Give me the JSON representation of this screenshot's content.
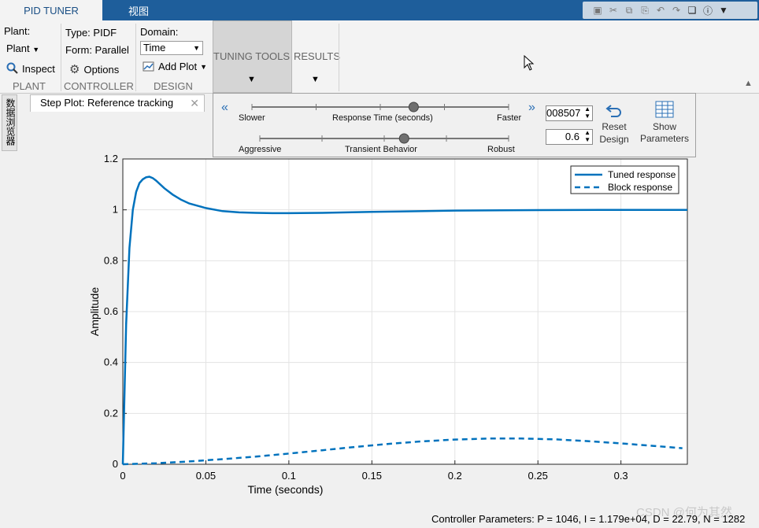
{
  "tabs": {
    "active": "PID TUNER",
    "second": "视图"
  },
  "ribbon": {
    "plant_label": "Plant:",
    "plant_value": "Plant",
    "inspect": "Inspect",
    "type": "Type: PIDF",
    "form": "Form: Parallel",
    "options": "Options",
    "domain_label": "Domain:",
    "domain_value": "Time",
    "add_plot": "Add Plot",
    "tuning_tools": "TUNING TOOLS",
    "results": "RESULTS",
    "groups": {
      "plant": "PLANT",
      "controller": "CONTROLLER",
      "design": "DESIGN"
    }
  },
  "doc": {
    "side_tab": "数据浏览器",
    "tab_title": "Step Plot: Reference tracking"
  },
  "tuner": {
    "slow_left": "Slower",
    "time_label": "Response Time (seconds)",
    "fast_right": "Faster",
    "aggr_left": "Aggressive",
    "transient_label": "Transient Behavior",
    "robust_right": "Robust",
    "response_value": "008507",
    "transient_value": "0.6",
    "reset": [
      "Reset",
      "Design"
    ],
    "show": [
      "Show",
      "Parameters"
    ],
    "response_pos": 0.63,
    "transient_pos": 0.58
  },
  "chart_data": {
    "type": "line",
    "xlabel": "Time (seconds)",
    "ylabel": "Amplitude",
    "xlim": [
      0,
      0.34
    ],
    "ylim": [
      0,
      1.2
    ],
    "xticks": [
      "0",
      "0.05",
      "0.1",
      "0.15",
      "0.2",
      "0.25",
      "0.3"
    ],
    "yticks": [
      "0",
      "0.2",
      "0.4",
      "0.6",
      "0.8",
      "1",
      "1.2"
    ],
    "grid": true,
    "legend_placement": "top-right",
    "color": "#0072bd",
    "series": [
      {
        "name": "Tuned response",
        "style": "solid",
        "x": [
          0,
          0.002,
          0.004,
          0.006,
          0.008,
          0.01,
          0.012,
          0.014,
          0.016,
          0.018,
          0.02,
          0.025,
          0.03,
          0.035,
          0.04,
          0.05,
          0.06,
          0.07,
          0.08,
          0.09,
          0.1,
          0.12,
          0.15,
          0.2,
          0.25,
          0.3,
          0.34
        ],
        "y": [
          0,
          0.55,
          0.85,
          1.0,
          1.07,
          1.105,
          1.12,
          1.128,
          1.13,
          1.125,
          1.115,
          1.085,
          1.06,
          1.04,
          1.025,
          1.007,
          0.995,
          0.99,
          0.988,
          0.987,
          0.987,
          0.988,
          0.992,
          0.997,
          0.999,
          1.0,
          1.0
        ]
      },
      {
        "name": "Block response",
        "style": "dashed",
        "x": [
          0,
          0.02,
          0.04,
          0.06,
          0.08,
          0.1,
          0.12,
          0.14,
          0.16,
          0.18,
          0.2,
          0.22,
          0.24,
          0.26,
          0.28,
          0.3,
          0.32,
          0.337
        ],
        "y": [
          0,
          0.004,
          0.011,
          0.02,
          0.03,
          0.042,
          0.055,
          0.068,
          0.08,
          0.09,
          0.097,
          0.101,
          0.101,
          0.098,
          0.091,
          0.082,
          0.072,
          0.063
        ]
      }
    ]
  },
  "footer": "Controller Parameters: P = 1046, I = 1.179e+04, D = 22.79, N = 1282",
  "watermark": "CSDN @何为其然"
}
